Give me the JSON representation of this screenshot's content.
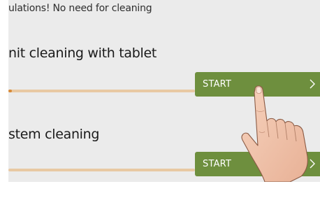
{
  "status": {
    "message": "ulations! No need for cleaning"
  },
  "sections": [
    {
      "title": "nit cleaning with tablet",
      "button_label": "START",
      "progress": 0.02
    },
    {
      "title": "stem cleaning",
      "button_label": "START",
      "progress": 0
    }
  ],
  "colors": {
    "background": "#ebebeb",
    "button": "#6e8f3e",
    "progress_track": "#e8c9a3",
    "progress_fill": "#d88b3a"
  },
  "icons": {
    "chevron": "chevron-right-icon",
    "hand": "pointing-hand-icon"
  }
}
